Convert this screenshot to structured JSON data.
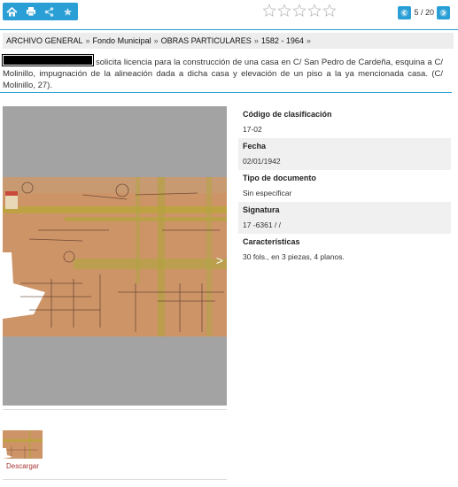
{
  "toolbar": {
    "icons": [
      "home-icon",
      "print-icon",
      "share-icon",
      "favorite-star-icon"
    ],
    "accent": "#2a9fd6"
  },
  "rating": {
    "stars_total": 5,
    "stars_filled": 0
  },
  "pagination": {
    "text": "5 / 20"
  },
  "breadcrumb": {
    "items": [
      "ARCHIVO GENERAL",
      "Fondo Municipal",
      "OBRAS PARTICULARES",
      "1582 - 1964"
    ],
    "separator": "»"
  },
  "description": {
    "text": "solicita licencia para la construcción de una casa en C/ San Pedro de Cardeña, esquina a C/ Molinillo, impugnación de la alineación dada a dicha casa y elevación de un piso a la ya mencionada casa. (C/ Molinillo, 27)."
  },
  "viewer": {
    "next_arrow": ">"
  },
  "thumbnail": {
    "download_label": "Descargar"
  },
  "metadata": [
    {
      "label": "Código de clasificación",
      "value": "17-02"
    },
    {
      "label": "Fecha",
      "value": "02/01/1942"
    },
    {
      "label": "Tipo de documento",
      "value": "Sin especificar"
    },
    {
      "label": "Signatura",
      "value": "17 -6361 / /"
    },
    {
      "label": "Características",
      "value": "30 fols., en 3 piezas, 4 planos."
    }
  ]
}
